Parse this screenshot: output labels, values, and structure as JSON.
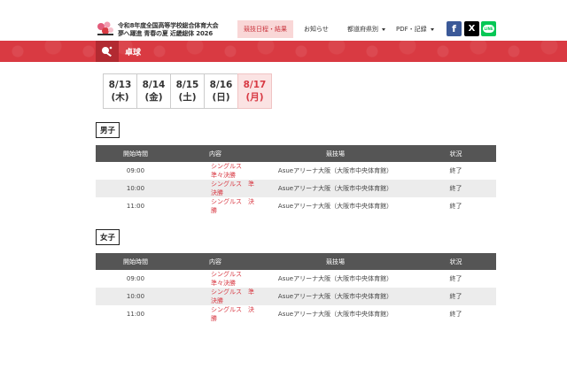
{
  "header": {
    "title_line1": "令和8年度全国高等学校総合体育大会",
    "title_line2": "夢へ躍進 青春の夏 近畿総体 2026",
    "nav": {
      "results": "競技日程・結果",
      "news": "お知らせ",
      "prefecture": "都道府県別",
      "pdf": "PDF・記録"
    },
    "social": {
      "facebook": "f",
      "x": "X",
      "line": "LINE"
    }
  },
  "banner": {
    "sport": "卓球"
  },
  "dates": [
    {
      "date": "8/13",
      "day": "(木)",
      "active": false
    },
    {
      "date": "8/14",
      "day": "(金)",
      "active": false
    },
    {
      "date": "8/15",
      "day": "(土)",
      "active": false
    },
    {
      "date": "8/16",
      "day": "(日)",
      "active": false
    },
    {
      "date": "8/17",
      "day": "(月)",
      "active": true
    }
  ],
  "columns": {
    "time": "開始時間",
    "content": "内容",
    "venue": "競技場",
    "status": "状況"
  },
  "sections": {
    "men": {
      "label": "男子",
      "rows": [
        {
          "time": "09:00",
          "event": "シングルス　準々決勝",
          "venue": "Asueアリーナ大阪（大阪市中央体育館）",
          "status": "終了"
        },
        {
          "time": "10:00",
          "event": "シングルス　準決勝",
          "venue": "Asueアリーナ大阪（大阪市中央体育館）",
          "status": "終了"
        },
        {
          "time": "11:00",
          "event": "シングルス　決勝",
          "venue": "Asueアリーナ大阪（大阪市中央体育館）",
          "status": "終了"
        }
      ]
    },
    "women": {
      "label": "女子",
      "rows": [
        {
          "time": "09:00",
          "event": "シングルス　準々決勝",
          "venue": "Asueアリーナ大阪（大阪市中央体育館）",
          "status": "終了"
        },
        {
          "time": "10:00",
          "event": "シングルス　準決勝",
          "venue": "Asueアリーナ大阪（大阪市中央体育館）",
          "status": "終了"
        },
        {
          "time": "11:00",
          "event": "シングルス　決勝",
          "venue": "Asueアリーナ大阪（大阪市中央体育館）",
          "status": "終了"
        }
      ]
    }
  },
  "colors": {
    "accent": "#d93a42",
    "accent_dark": "#b22a31",
    "active_tab_bg": "#fbe3e3",
    "table_header": "#555555"
  },
  "icons": {
    "logo": "tournament-logo-icon",
    "sport": "table-tennis-icon"
  }
}
